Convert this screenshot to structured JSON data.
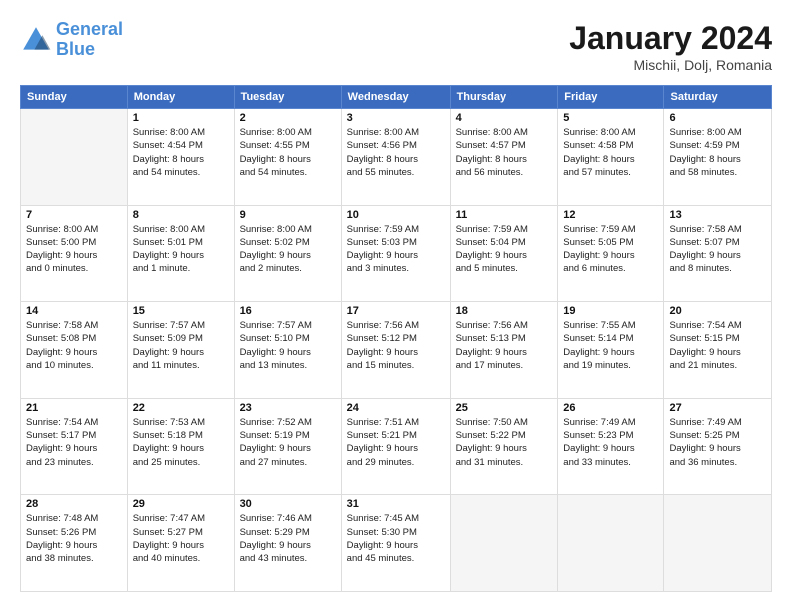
{
  "logo": {
    "line1": "General",
    "line2": "Blue"
  },
  "header": {
    "month": "January 2024",
    "location": "Mischii, Dolj, Romania"
  },
  "weekdays": [
    "Sunday",
    "Monday",
    "Tuesday",
    "Wednesday",
    "Thursday",
    "Friday",
    "Saturday"
  ],
  "weeks": [
    [
      {
        "day": "",
        "info": ""
      },
      {
        "day": "1",
        "info": "Sunrise: 8:00 AM\nSunset: 4:54 PM\nDaylight: 8 hours\nand 54 minutes."
      },
      {
        "day": "2",
        "info": "Sunrise: 8:00 AM\nSunset: 4:55 PM\nDaylight: 8 hours\nand 54 minutes."
      },
      {
        "day": "3",
        "info": "Sunrise: 8:00 AM\nSunset: 4:56 PM\nDaylight: 8 hours\nand 55 minutes."
      },
      {
        "day": "4",
        "info": "Sunrise: 8:00 AM\nSunset: 4:57 PM\nDaylight: 8 hours\nand 56 minutes."
      },
      {
        "day": "5",
        "info": "Sunrise: 8:00 AM\nSunset: 4:58 PM\nDaylight: 8 hours\nand 57 minutes."
      },
      {
        "day": "6",
        "info": "Sunrise: 8:00 AM\nSunset: 4:59 PM\nDaylight: 8 hours\nand 58 minutes."
      }
    ],
    [
      {
        "day": "7",
        "info": "Sunrise: 8:00 AM\nSunset: 5:00 PM\nDaylight: 9 hours\nand 0 minutes."
      },
      {
        "day": "8",
        "info": "Sunrise: 8:00 AM\nSunset: 5:01 PM\nDaylight: 9 hours\nand 1 minute."
      },
      {
        "day": "9",
        "info": "Sunrise: 8:00 AM\nSunset: 5:02 PM\nDaylight: 9 hours\nand 2 minutes."
      },
      {
        "day": "10",
        "info": "Sunrise: 7:59 AM\nSunset: 5:03 PM\nDaylight: 9 hours\nand 3 minutes."
      },
      {
        "day": "11",
        "info": "Sunrise: 7:59 AM\nSunset: 5:04 PM\nDaylight: 9 hours\nand 5 minutes."
      },
      {
        "day": "12",
        "info": "Sunrise: 7:59 AM\nSunset: 5:05 PM\nDaylight: 9 hours\nand 6 minutes."
      },
      {
        "day": "13",
        "info": "Sunrise: 7:58 AM\nSunset: 5:07 PM\nDaylight: 9 hours\nand 8 minutes."
      }
    ],
    [
      {
        "day": "14",
        "info": "Sunrise: 7:58 AM\nSunset: 5:08 PM\nDaylight: 9 hours\nand 10 minutes."
      },
      {
        "day": "15",
        "info": "Sunrise: 7:57 AM\nSunset: 5:09 PM\nDaylight: 9 hours\nand 11 minutes."
      },
      {
        "day": "16",
        "info": "Sunrise: 7:57 AM\nSunset: 5:10 PM\nDaylight: 9 hours\nand 13 minutes."
      },
      {
        "day": "17",
        "info": "Sunrise: 7:56 AM\nSunset: 5:12 PM\nDaylight: 9 hours\nand 15 minutes."
      },
      {
        "day": "18",
        "info": "Sunrise: 7:56 AM\nSunset: 5:13 PM\nDaylight: 9 hours\nand 17 minutes."
      },
      {
        "day": "19",
        "info": "Sunrise: 7:55 AM\nSunset: 5:14 PM\nDaylight: 9 hours\nand 19 minutes."
      },
      {
        "day": "20",
        "info": "Sunrise: 7:54 AM\nSunset: 5:15 PM\nDaylight: 9 hours\nand 21 minutes."
      }
    ],
    [
      {
        "day": "21",
        "info": "Sunrise: 7:54 AM\nSunset: 5:17 PM\nDaylight: 9 hours\nand 23 minutes."
      },
      {
        "day": "22",
        "info": "Sunrise: 7:53 AM\nSunset: 5:18 PM\nDaylight: 9 hours\nand 25 minutes."
      },
      {
        "day": "23",
        "info": "Sunrise: 7:52 AM\nSunset: 5:19 PM\nDaylight: 9 hours\nand 27 minutes."
      },
      {
        "day": "24",
        "info": "Sunrise: 7:51 AM\nSunset: 5:21 PM\nDaylight: 9 hours\nand 29 minutes."
      },
      {
        "day": "25",
        "info": "Sunrise: 7:50 AM\nSunset: 5:22 PM\nDaylight: 9 hours\nand 31 minutes."
      },
      {
        "day": "26",
        "info": "Sunrise: 7:49 AM\nSunset: 5:23 PM\nDaylight: 9 hours\nand 33 minutes."
      },
      {
        "day": "27",
        "info": "Sunrise: 7:49 AM\nSunset: 5:25 PM\nDaylight: 9 hours\nand 36 minutes."
      }
    ],
    [
      {
        "day": "28",
        "info": "Sunrise: 7:48 AM\nSunset: 5:26 PM\nDaylight: 9 hours\nand 38 minutes."
      },
      {
        "day": "29",
        "info": "Sunrise: 7:47 AM\nSunset: 5:27 PM\nDaylight: 9 hours\nand 40 minutes."
      },
      {
        "day": "30",
        "info": "Sunrise: 7:46 AM\nSunset: 5:29 PM\nDaylight: 9 hours\nand 43 minutes."
      },
      {
        "day": "31",
        "info": "Sunrise: 7:45 AM\nSunset: 5:30 PM\nDaylight: 9 hours\nand 45 minutes."
      },
      {
        "day": "",
        "info": ""
      },
      {
        "day": "",
        "info": ""
      },
      {
        "day": "",
        "info": ""
      }
    ]
  ]
}
